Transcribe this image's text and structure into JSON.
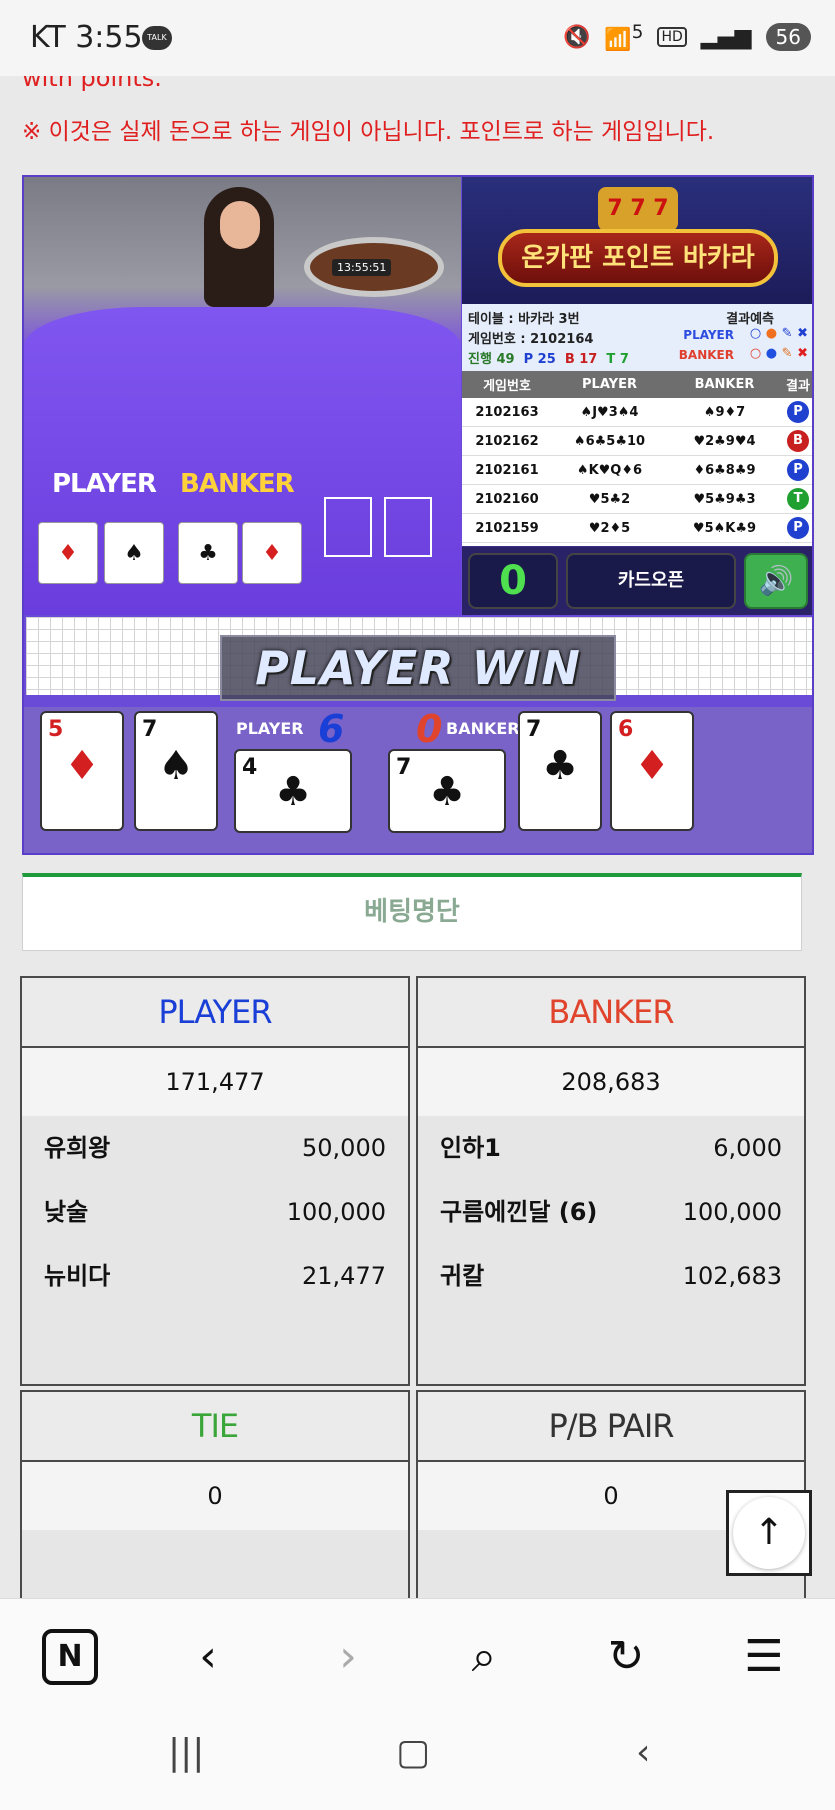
{
  "status": {
    "carrier_time": "KT 3:55",
    "talk": "TALK",
    "battery": "56",
    "hd": "HD",
    "wifi": "5"
  },
  "notice": {
    "top_fragment": "with points.",
    "message": "※ 이것은 실제 돈으로 하는 게임이 아닙니다. 포인트로 하는 게임입니다."
  },
  "live": {
    "clock": "13:55:51",
    "player_label": "PLAYER",
    "banker_label": "BANKER"
  },
  "logo": {
    "title": "온카판 포인트 바카라",
    "reels": "7 7 7"
  },
  "info": {
    "table": "테이블 : 바카라 3번",
    "game_no": "게임번호 : 2102164",
    "progress": "진행 49",
    "p_count": "P 25",
    "b_count": "B 17",
    "t_count": "T 7",
    "prediction": "결과예측",
    "player": "PLAYER",
    "banker": "BANKER"
  },
  "history": {
    "headers": [
      "게임번호",
      "PLAYER",
      "BANKER",
      "결과"
    ],
    "rows": [
      {
        "no": "2102163",
        "player": "♠J♥3♠4",
        "banker": "♠9♦7",
        "result": "P"
      },
      {
        "no": "2102162",
        "player": "♠6♣5♣10",
        "banker": "♥2♣9♥4",
        "result": "B"
      },
      {
        "no": "2102161",
        "player": "♠K♥Q♦6",
        "banker": "♦6♣8♣9",
        "result": "P"
      },
      {
        "no": "2102160",
        "player": "♥5♣2",
        "banker": "♥5♣9♣3",
        "result": "T"
      },
      {
        "no": "2102159",
        "player": "♥2♦5",
        "banker": "♥5♠K♣9",
        "result": "P"
      }
    ]
  },
  "controls": {
    "counter": "0",
    "open_label": "카드오픈",
    "sound": "🔊"
  },
  "result_banner": "PLAYER WIN",
  "reveal": {
    "player_label": "PLAYER",
    "player_score": "6",
    "banker_label": "BANKER",
    "banker_score": "0",
    "cards": [
      {
        "rank": "5",
        "suit": "♦"
      },
      {
        "rank": "7",
        "suit": "♠"
      },
      {
        "rank": "4",
        "suit": "♣"
      },
      {
        "rank": "7",
        "suit": "♣"
      },
      {
        "rank": "7",
        "suit": "♣"
      },
      {
        "rank": "6",
        "suit": "♦"
      }
    ]
  },
  "betting": {
    "title": "베팅명단",
    "player": {
      "label": "PLAYER",
      "total": "171,477",
      "rows": [
        {
          "name": "유희왕",
          "amount": "50,000"
        },
        {
          "name": "낮술",
          "amount": "100,000"
        },
        {
          "name": "뉴비다",
          "amount": "21,477"
        }
      ]
    },
    "banker": {
      "label": "BANKER",
      "total": "208,683",
      "rows": [
        {
          "name": "인하1",
          "amount": "6,000"
        },
        {
          "name": "구름에낀달 (6)",
          "amount": "100,000"
        },
        {
          "name": "귀칼",
          "amount": "102,683"
        }
      ]
    },
    "tie": {
      "label": "TIE",
      "total": "0"
    },
    "pair": {
      "label": "P/B PAIR",
      "total": "0"
    }
  },
  "colors": {
    "player": "#1a3fd6",
    "banker": "#e0442c",
    "tie": "#3aa63a",
    "pair": "#333333"
  }
}
